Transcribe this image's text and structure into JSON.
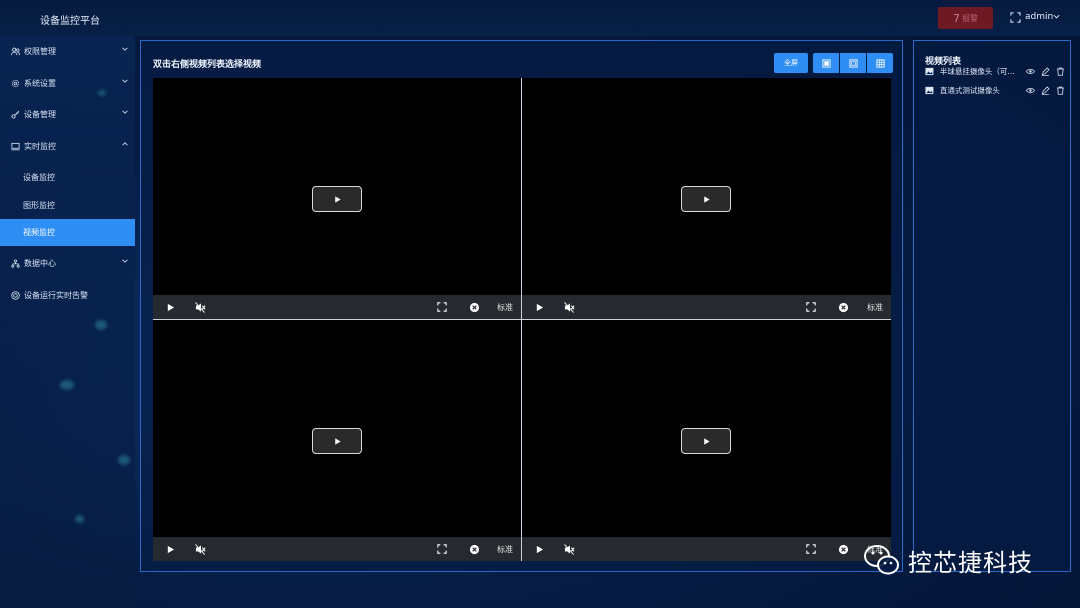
{
  "header": {
    "app_title": "设备监控平台",
    "alarm_count": "7",
    "alarm_label": "报警",
    "user": "admin"
  },
  "sidebar": {
    "items": [
      {
        "label": "权限管理",
        "icon": "users-icon",
        "expanded": false
      },
      {
        "label": "系统设置",
        "icon": "gear-icon",
        "expanded": false
      },
      {
        "label": "设备管理",
        "icon": "key-icon",
        "expanded": false
      },
      {
        "label": "实时监控",
        "icon": "monitor-icon",
        "expanded": true
      },
      {
        "label": "设备监控",
        "sub": true
      },
      {
        "label": "图形监控",
        "sub": true
      },
      {
        "label": "视频监控",
        "sub": true,
        "active": true
      },
      {
        "label": "数据中心",
        "icon": "network-icon",
        "expanded": false
      },
      {
        "label": "设备运行实时告警",
        "icon": "alert-circle-icon"
      }
    ]
  },
  "main": {
    "title": "双击右侧视频列表选择视频",
    "fullscreen_label": "全屏",
    "layouts": [
      "single-layout-icon",
      "quad-layout-icon",
      "nine-layout-icon"
    ],
    "videos": [
      {
        "quality": "标准"
      },
      {
        "quality": "标准"
      },
      {
        "quality": "标准"
      },
      {
        "quality": "标准"
      }
    ]
  },
  "video_list": {
    "title": "视频列表",
    "items": [
      {
        "name": "半球悬挂摄像头（可旋转）"
      },
      {
        "name": "直通式测试摄像头"
      }
    ]
  },
  "watermark": {
    "text": "控芯捷科技"
  },
  "colors": {
    "accent": "#2f8ef4",
    "alarm": "#6e1a24",
    "panel_border": "#2a6ac7"
  }
}
